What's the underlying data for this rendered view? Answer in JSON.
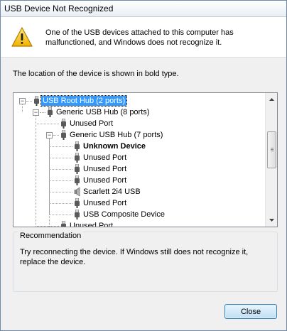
{
  "window": {
    "title": "USB Device Not Recognized"
  },
  "header": {
    "icon": "warning-icon",
    "message": "One of the USB devices attached to this computer has malfunctioned, and Windows does not recognize it."
  },
  "location_text": "The location of the device is shown in bold type.",
  "tree": {
    "items": [
      {
        "label": "USB Root Hub (2 ports)",
        "icon": "usb-hub-icon",
        "level": 0,
        "expanded": true,
        "selected": true
      },
      {
        "label": "Generic USB Hub (8 ports)",
        "icon": "usb-hub-icon",
        "level": 1,
        "expanded": true
      },
      {
        "label": "Unused Port",
        "icon": "usb-plug-icon",
        "level": 2
      },
      {
        "label": "Generic USB Hub (7 ports)",
        "icon": "usb-hub-icon",
        "level": 2,
        "expanded": true
      },
      {
        "label": "Unknown Device",
        "icon": "usb-plug-icon",
        "level": 3,
        "bold": true
      },
      {
        "label": "Unused Port",
        "icon": "usb-plug-icon",
        "level": 3
      },
      {
        "label": "Unused Port",
        "icon": "usb-plug-icon",
        "level": 3
      },
      {
        "label": "Unused Port",
        "icon": "usb-plug-icon",
        "level": 3
      },
      {
        "label": "Scarlett 2i4 USB",
        "icon": "speaker-icon",
        "level": 3
      },
      {
        "label": "Unused Port",
        "icon": "usb-plug-icon",
        "level": 3
      },
      {
        "label": "USB Composite Device",
        "icon": "usb-plug-icon",
        "level": 3
      },
      {
        "label": "Unused Port",
        "icon": "usb-plug-icon",
        "level": 2
      }
    ]
  },
  "recommendation": {
    "heading": "Recommendation",
    "text": "Try reconnecting the device. If Windows still does not recognize it, replace the device."
  },
  "buttons": {
    "close": "Close"
  },
  "colors": {
    "selection": "#3399ff",
    "button_border": "#3c7fb1"
  }
}
